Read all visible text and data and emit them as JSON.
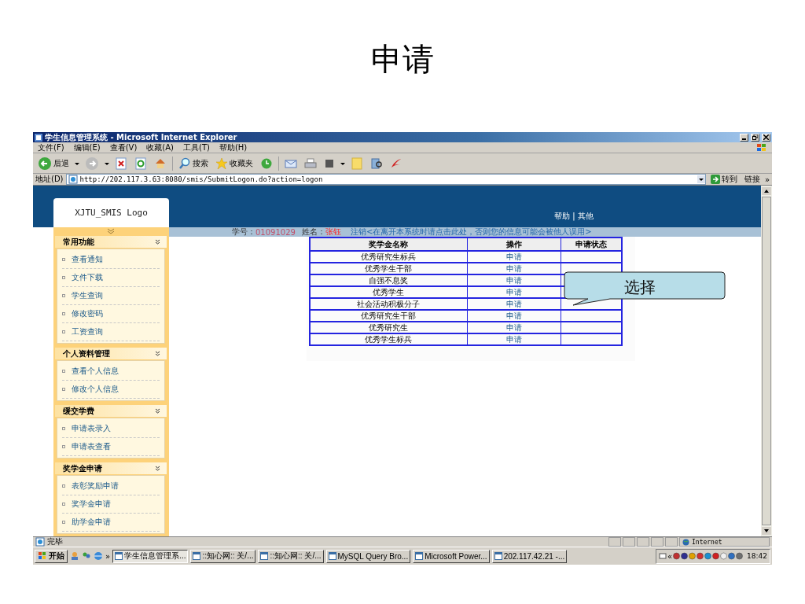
{
  "slide": {
    "title": "申请"
  },
  "window": {
    "title": "学生信息管理系统 - Microsoft Internet Explorer"
  },
  "menu": [
    "文件(F)",
    "编辑(E)",
    "查看(V)",
    "收藏(A)",
    "工具(T)",
    "帮助(H)"
  ],
  "toolbar": {
    "back": "后退",
    "search": "搜索",
    "favorites": "收藏夹"
  },
  "address": {
    "label": "地址(D)",
    "value": "http://202.117.3.63:8080/smis/SubmitLogon.do?action=logon",
    "go": "转到",
    "links": "链接",
    "more": "»"
  },
  "page": {
    "logo": "XJTU_SMIS Logo",
    "header_links": "帮助 | 其他",
    "student_id_label": "学号：",
    "student_id": "01091029",
    "name_label": "姓名：",
    "name": "张钰",
    "logout": "注销<在离开本系统时请点击此处，否则您的信息可能会被他人误用>"
  },
  "sidebar": {
    "sections": [
      {
        "title": "常用功能",
        "items": [
          "查看通知",
          "文件下载",
          "学生查询",
          "修改密码",
          "工资查询"
        ]
      },
      {
        "title": "个人资料管理",
        "items": [
          "查看个人信息",
          "修改个人信息"
        ]
      },
      {
        "title": "缓交学费",
        "items": [
          "申请表录入",
          "申请表查看"
        ]
      },
      {
        "title": "奖学金申请",
        "items": [
          "表彰奖励申请",
          "奖学金申请",
          "助学金申请"
        ]
      }
    ]
  },
  "table": {
    "columns": [
      "奖学金名称",
      "操作",
      "申请状态"
    ],
    "rows": [
      {
        "name": "优秀研究生标兵",
        "action": "申请"
      },
      {
        "name": "优秀学生干部",
        "action": "申请"
      },
      {
        "name": "自强不息奖",
        "action": "申请"
      },
      {
        "name": "优秀学生",
        "action": "申请"
      },
      {
        "name": "社会活动积极分子",
        "action": "申请"
      },
      {
        "name": "优秀研究生干部",
        "action": "申请"
      },
      {
        "name": "优秀研究生",
        "action": "申请"
      },
      {
        "name": "优秀学生标兵",
        "action": "申请"
      }
    ]
  },
  "callout": {
    "text": "选择"
  },
  "status_bar": {
    "text": "完毕",
    "zone": "Internet"
  },
  "taskbar": {
    "start": "开始",
    "more": "»",
    "tasks": [
      {
        "label": "学生信息管理系...",
        "selected": true
      },
      {
        "label": "::知心网:: 关/...",
        "selected": false
      },
      {
        "label": "::知心网:: 关/...",
        "selected": false
      },
      {
        "label": "MySQL Query Bro...",
        "selected": false
      },
      {
        "label": "Microsoft Power...",
        "selected": false
      },
      {
        "label": "202.117.42.21 -...",
        "selected": false
      }
    ],
    "tray_more": "«",
    "clock": "18:42"
  }
}
